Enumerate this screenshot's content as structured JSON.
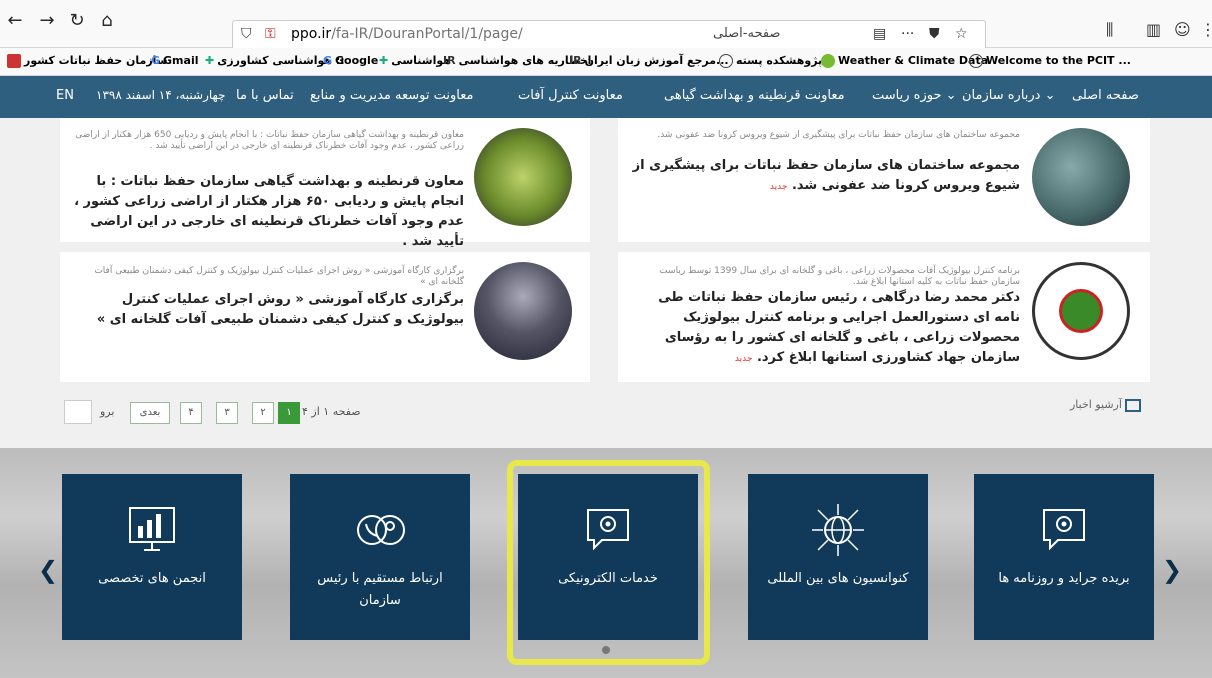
{
  "browser": {
    "url_host": "ppo.ir",
    "url_path": "/fa-IR/DouranPortal/1/page/",
    "url_title": "صفحه-اصلی",
    "icons": {
      "back": "back-arrow-icon",
      "forward": "forward-arrow-icon",
      "reload": "reload-icon",
      "home": "home-icon"
    }
  },
  "bookmarks": [
    {
      "label": "سازمان حفظ نباتات کشور",
      "icon": "ppo-logo-icon"
    },
    {
      "label": "Gmail",
      "icon": "google-icon"
    },
    {
      "label": "هواشناسی کشاورزی ::",
      "icon": "weather-plus-icon"
    },
    {
      "label": "Google",
      "icon": "google-icon"
    },
    {
      "label": "هواشناسی",
      "icon": "weather-plus-icon"
    },
    {
      "label": "اخطاریه های هواشناسی",
      "icon": "ir-icon"
    },
    {
      "label": "مرجع آموزش زبان ایران...",
      "icon": "ir-icon"
    },
    {
      "label": "پژوهشکده پسته",
      "icon": "globe-icon"
    },
    {
      "label": "Weather & Climate Data",
      "icon": "weather-icon"
    },
    {
      "label": "Welcome to the PCIT ...",
      "icon": "globe-icon"
    }
  ],
  "nav": {
    "home": "صفحه اصلی",
    "about": "درباره سازمان",
    "presidency": "حوزه ریاست",
    "quarantine": "معاونت قرنطینه و بهداشت گیاهی",
    "pest_control": "معاونت کنترل آفات",
    "management": "معاونت توسعه مدیریت و منابع",
    "contact": "تماس با ما",
    "date": "چهارشنبه، ۱۴ اسفند ۱۳۹۸",
    "lang": "EN"
  },
  "news": [
    {
      "small": "مجموعه ساختمان های سازمان حفظ نباتات برای پیشگیری از شیوع ویروس کرونا ضد عفونی شد.",
      "big": "مجموعه ساختمان های سازمان حفظ نباتات برای پیشگیری از شیوع ویروس کرونا ضد عفونی شد.",
      "badge": "جدید"
    },
    {
      "small": "معاون قرنطینه و بهداشت گیاهی سازمان حفظ نباتات : با انجام پایش و ردیابی 650 هزار هکتار از اراضی زراعی کشور ، عدم وجود آفات خطرناک قرنطینه ای خارجی در این اراضی تأیید شد .",
      "big": "معاون قرنطینه و بهداشت گیاهی سازمان حفظ نباتات : با انجام پایش و ردیابی ۶۵۰ هزار هکتار از اراضی زراعی کشور ، عدم وجود آفات خطرناک قرنطینه ای خارجی در این اراضی تأیید شد ."
    },
    {
      "small": "برنامه کنترل بیولوژیک آفات محصولات زراعی ، باغی و گلخانه ای برای سال 1399 توسط ریاست سازمان حفظ نباتات به کلیه استانها ابلاغ شد.",
      "big": "دکتر محمد رضا درگاهی ، رئیس سازمان حفظ نباتات طی نامه ای دستورالعمل اجرایی و برنامه کنترل بیولوژیک محصولات زراعی ، باغی و گلخانه ای کشور را به رؤسای سازمان جهاد کشاورزی استانها ابلاغ کرد.",
      "badge": "جدید"
    },
    {
      "small": "برگزاری کارگاه آموزشی « روش اجرای عملیات کنترل بیولوژیک و کنترل کیفی دشمنان طبیعی آفات گلخانه ای »",
      "big": "برگزاری کارگاه آموزشی « روش اجرای عملیات کنترل بیولوژیک و کنترل کیفی دشمنان طبیعی آفات گلخانه ای »"
    }
  ],
  "pager": {
    "page_info": "صفحه ۱ از ۴",
    "pages": [
      "۱",
      "۲",
      "۳",
      "۴"
    ],
    "next": "بعدی",
    "go": "برو",
    "archive": "آرشیو اخبار"
  },
  "tiles": [
    {
      "label": "بریده جراید و روزنامه ها",
      "icon": "news-gear-icon"
    },
    {
      "label": "کنوانسیون های بین المللی",
      "icon": "network-globe-icon"
    },
    {
      "label": "خدمات الکترونیکی",
      "icon": "e-services-gear-icon"
    },
    {
      "label": "ارتباط مستقیم با رئیس سازمان",
      "icon": "phone-contact-icon"
    },
    {
      "label": "انجمن های تخصصی",
      "icon": "presentation-chart-icon"
    }
  ],
  "colors": {
    "navbar": "#2f5f7e",
    "tile": "#113a5a",
    "highlight": "#e8e84a"
  }
}
